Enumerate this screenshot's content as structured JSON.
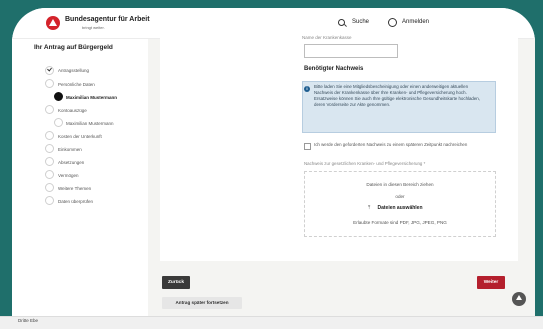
{
  "header": {
    "brand_title": "Bundesagentur für Arbeit",
    "brand_subtitle": "bringt weiter.",
    "search_label": "Suche",
    "login_label": "Anmelden"
  },
  "sidebar": {
    "title": "Ihr Antrag auf Bürgergeld",
    "steps": [
      {
        "label": "Antragsstellung",
        "state": "done"
      },
      {
        "label": "Persönliche Daten",
        "state": "normal"
      },
      {
        "label": "Maximilian Mustermann",
        "state": "active"
      },
      {
        "label": "Kontoauszüge",
        "state": "normal"
      },
      {
        "label": "Maximilian Mustermann",
        "state": "normal"
      },
      {
        "label": "Kosten der Unterkunft",
        "state": "normal"
      },
      {
        "label": "Einkommen",
        "state": "normal"
      },
      {
        "label": "Absetzungen",
        "state": "normal"
      },
      {
        "label": "Vermögen",
        "state": "normal"
      },
      {
        "label": "Weitere Themen",
        "state": "normal"
      },
      {
        "label": "Daten überprüfen",
        "state": "normal"
      }
    ]
  },
  "form": {
    "top_field_label": "Name der Krankenkasse",
    "top_field_value": "",
    "section_title": "Benötigter Nachweis",
    "info_text": "Bitte laden Sie eine Mitgliedsbescheinigung oder einen anderweitigen aktuellen Nachweis der Krankenkasse über Ihre Kranken- und Pflegeversicherung hoch. Ersatzweise können Sie auch Ihre gültige elektronische Gesundheitskarte hochladen, deren Vorderseite zur Akte genommen.",
    "checkbox_label": "Ich werde den geforderten Nachweis zu einem späteren Zeitpunkt nachreichen",
    "upload_label": "Nachweis zur gesetzlichen Kranken- und Pflegeversicherung *",
    "dropzone_text": "Dateien in diesen Bereich ziehen",
    "dropzone_or": "oder",
    "dropzone_select": "Dateien auswählen",
    "dropzone_formats": "Erlaubte Formate sind PDF, JPG, JPEG, PNG"
  },
  "actions": {
    "back": "Zurück",
    "next": "Weiter",
    "later": "Antrag später fortsetzen"
  },
  "bottom": {
    "label": "Dritte Ebe"
  },
  "colors": {
    "brand": "#d4232b",
    "primary": "#b41f2d",
    "info_bg": "#d9e6f0",
    "frame_bg": "#1f6f6b"
  }
}
